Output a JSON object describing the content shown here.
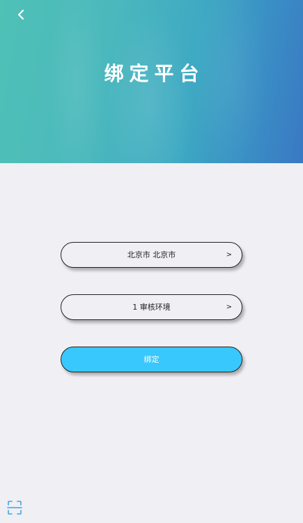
{
  "header": {
    "title": "绑定平台",
    "back_icon": "chevron-left-icon"
  },
  "form": {
    "city_select": {
      "value": "北京市 北京市",
      "arrow": ">"
    },
    "env_select": {
      "value": "1 审核环境",
      "arrow": ">"
    },
    "bind_button_label": "绑定"
  },
  "footer": {
    "scan_icon": "scan-icon"
  },
  "colors": {
    "header_gradient_start": "#4fc1b6",
    "header_gradient_end": "#3a78c4",
    "background": "#efeff4",
    "primary_button": "#38c8fd",
    "scan_icon": "#3aa5e8"
  }
}
